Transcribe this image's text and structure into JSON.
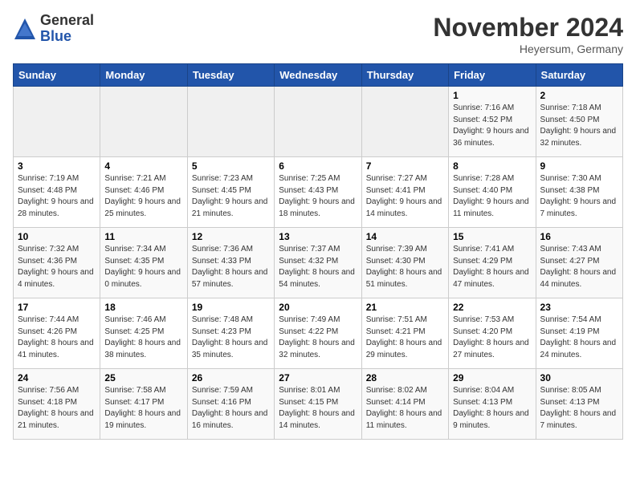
{
  "header": {
    "logo_general": "General",
    "logo_blue": "Blue",
    "title": "November 2024",
    "location": "Heyersum, Germany"
  },
  "days_of_week": [
    "Sunday",
    "Monday",
    "Tuesday",
    "Wednesday",
    "Thursday",
    "Friday",
    "Saturday"
  ],
  "weeks": [
    [
      {
        "day": "",
        "sunrise": "",
        "sunset": "",
        "daylight": ""
      },
      {
        "day": "",
        "sunrise": "",
        "sunset": "",
        "daylight": ""
      },
      {
        "day": "",
        "sunrise": "",
        "sunset": "",
        "daylight": ""
      },
      {
        "day": "",
        "sunrise": "",
        "sunset": "",
        "daylight": ""
      },
      {
        "day": "",
        "sunrise": "",
        "sunset": "",
        "daylight": ""
      },
      {
        "day": "1",
        "sunrise": "7:16 AM",
        "sunset": "4:52 PM",
        "daylight": "9 hours and 36 minutes."
      },
      {
        "day": "2",
        "sunrise": "7:18 AM",
        "sunset": "4:50 PM",
        "daylight": "9 hours and 32 minutes."
      }
    ],
    [
      {
        "day": "3",
        "sunrise": "7:19 AM",
        "sunset": "4:48 PM",
        "daylight": "9 hours and 28 minutes."
      },
      {
        "day": "4",
        "sunrise": "7:21 AM",
        "sunset": "4:46 PM",
        "daylight": "9 hours and 25 minutes."
      },
      {
        "day": "5",
        "sunrise": "7:23 AM",
        "sunset": "4:45 PM",
        "daylight": "9 hours and 21 minutes."
      },
      {
        "day": "6",
        "sunrise": "7:25 AM",
        "sunset": "4:43 PM",
        "daylight": "9 hours and 18 minutes."
      },
      {
        "day": "7",
        "sunrise": "7:27 AM",
        "sunset": "4:41 PM",
        "daylight": "9 hours and 14 minutes."
      },
      {
        "day": "8",
        "sunrise": "7:28 AM",
        "sunset": "4:40 PM",
        "daylight": "9 hours and 11 minutes."
      },
      {
        "day": "9",
        "sunrise": "7:30 AM",
        "sunset": "4:38 PM",
        "daylight": "9 hours and 7 minutes."
      }
    ],
    [
      {
        "day": "10",
        "sunrise": "7:32 AM",
        "sunset": "4:36 PM",
        "daylight": "9 hours and 4 minutes."
      },
      {
        "day": "11",
        "sunrise": "7:34 AM",
        "sunset": "4:35 PM",
        "daylight": "9 hours and 0 minutes."
      },
      {
        "day": "12",
        "sunrise": "7:36 AM",
        "sunset": "4:33 PM",
        "daylight": "8 hours and 57 minutes."
      },
      {
        "day": "13",
        "sunrise": "7:37 AM",
        "sunset": "4:32 PM",
        "daylight": "8 hours and 54 minutes."
      },
      {
        "day": "14",
        "sunrise": "7:39 AM",
        "sunset": "4:30 PM",
        "daylight": "8 hours and 51 minutes."
      },
      {
        "day": "15",
        "sunrise": "7:41 AM",
        "sunset": "4:29 PM",
        "daylight": "8 hours and 47 minutes."
      },
      {
        "day": "16",
        "sunrise": "7:43 AM",
        "sunset": "4:27 PM",
        "daylight": "8 hours and 44 minutes."
      }
    ],
    [
      {
        "day": "17",
        "sunrise": "7:44 AM",
        "sunset": "4:26 PM",
        "daylight": "8 hours and 41 minutes."
      },
      {
        "day": "18",
        "sunrise": "7:46 AM",
        "sunset": "4:25 PM",
        "daylight": "8 hours and 38 minutes."
      },
      {
        "day": "19",
        "sunrise": "7:48 AM",
        "sunset": "4:23 PM",
        "daylight": "8 hours and 35 minutes."
      },
      {
        "day": "20",
        "sunrise": "7:49 AM",
        "sunset": "4:22 PM",
        "daylight": "8 hours and 32 minutes."
      },
      {
        "day": "21",
        "sunrise": "7:51 AM",
        "sunset": "4:21 PM",
        "daylight": "8 hours and 29 minutes."
      },
      {
        "day": "22",
        "sunrise": "7:53 AM",
        "sunset": "4:20 PM",
        "daylight": "8 hours and 27 minutes."
      },
      {
        "day": "23",
        "sunrise": "7:54 AM",
        "sunset": "4:19 PM",
        "daylight": "8 hours and 24 minutes."
      }
    ],
    [
      {
        "day": "24",
        "sunrise": "7:56 AM",
        "sunset": "4:18 PM",
        "daylight": "8 hours and 21 minutes."
      },
      {
        "day": "25",
        "sunrise": "7:58 AM",
        "sunset": "4:17 PM",
        "daylight": "8 hours and 19 minutes."
      },
      {
        "day": "26",
        "sunrise": "7:59 AM",
        "sunset": "4:16 PM",
        "daylight": "8 hours and 16 minutes."
      },
      {
        "day": "27",
        "sunrise": "8:01 AM",
        "sunset": "4:15 PM",
        "daylight": "8 hours and 14 minutes."
      },
      {
        "day": "28",
        "sunrise": "8:02 AM",
        "sunset": "4:14 PM",
        "daylight": "8 hours and 11 minutes."
      },
      {
        "day": "29",
        "sunrise": "8:04 AM",
        "sunset": "4:13 PM",
        "daylight": "8 hours and 9 minutes."
      },
      {
        "day": "30",
        "sunrise": "8:05 AM",
        "sunset": "4:13 PM",
        "daylight": "8 hours and 7 minutes."
      }
    ]
  ]
}
